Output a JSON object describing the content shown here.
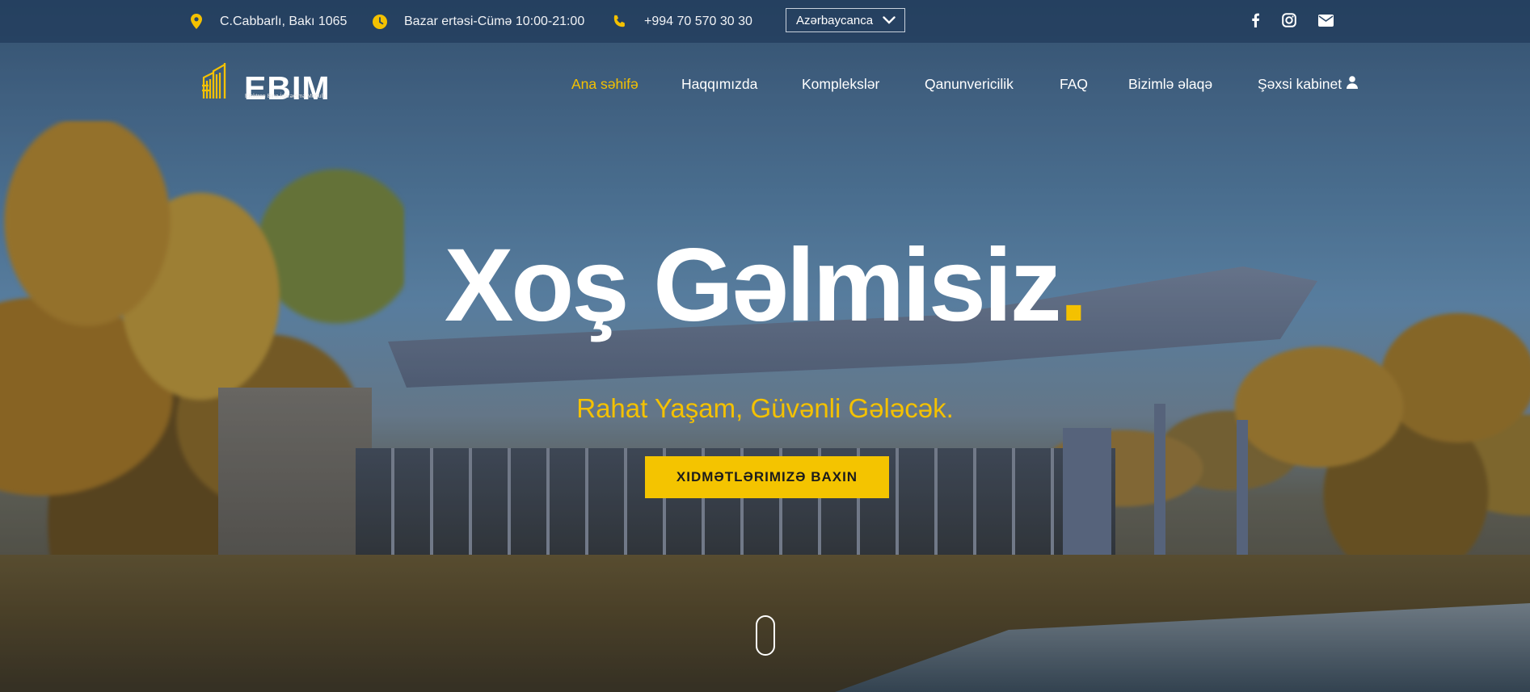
{
  "colors": {
    "accent": "#f4c100",
    "topbar": "#203a5a",
    "cta_bg": "#f4c400",
    "cta_text": "#1c1c1c"
  },
  "topbar": {
    "address": {
      "icon": "map-pin-icon",
      "text": "C.Cabbarlı, Bakı 1065"
    },
    "hours": {
      "icon": "clock-icon",
      "text": "Bazar ertəsi-Cümə 10:00-21:00"
    },
    "phone": {
      "icon": "phone-icon",
      "text": "+994 70 570 30 30"
    },
    "language": {
      "selected": "Azərbaycanca",
      "icon": "chevron-down-icon"
    },
    "social": [
      "facebook-icon",
      "instagram-icon",
      "envelope-icon"
    ]
  },
  "logo": {
    "word": "EBIM",
    "subtitle": "Elektron Bina İdarəetmə Modulu",
    "icon": "building-logo-icon"
  },
  "nav": {
    "items": [
      {
        "label": "Ana səhifə",
        "active": true
      },
      {
        "label": "Haqqımızda",
        "active": false
      },
      {
        "label": "Komplekslər",
        "active": false
      },
      {
        "label": "Qanunvericilik",
        "active": false
      },
      {
        "label": "FAQ",
        "active": false
      },
      {
        "label": "Bizimlə əlaqə",
        "active": false
      },
      {
        "label": "Şəxsi kabinet",
        "active": false,
        "icon": "user-icon"
      }
    ]
  },
  "hero": {
    "headline": "Xoş Gəlmisiz",
    "headline_dot": ".",
    "tagline": "Rahat Yaşam, Güvənli Gələcək.",
    "cta_label": "XIDMƏTLƏRIMIZƏ BAXIN",
    "scroll_icon": "mouse-scroll-icon"
  }
}
